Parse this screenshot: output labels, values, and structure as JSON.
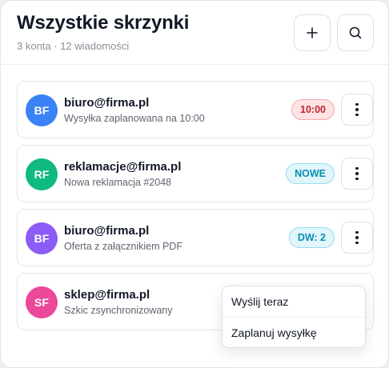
{
  "header": {
    "title": "Wszystkie skrzynki",
    "subtitle": "3 konta · 12 wiadomości"
  },
  "icons": {
    "add": "plus-icon",
    "search": "search-icon",
    "more": "more-vertical-icon"
  },
  "colors": {
    "avatar_blue": "#3b82f6",
    "avatar_green": "#10b981",
    "avatar_purple": "#8b5cf6",
    "avatar_pink": "#ec4899",
    "badge_red": "#c0262d",
    "badge_cyan": "#0b8db0"
  },
  "items": [
    {
      "initials": "BF",
      "email": "biuro@firma.pl",
      "snippet": "Wysyłka zaplanowana na 10:00",
      "badge": "10:00"
    },
    {
      "initials": "RF",
      "email": "reklamacje@firma.pl",
      "snippet": "Nowa reklamacja #2048",
      "badge": "NOWE"
    },
    {
      "initials": "BF",
      "email": "biuro@firma.pl",
      "snippet": "Oferta z załącznikiem PDF",
      "badge": "DW: 2"
    },
    {
      "initials": "SF",
      "email": "sklep@firma.pl",
      "snippet": "Szkic zsynchronizowany",
      "badge": ""
    }
  ],
  "menu": {
    "items": [
      {
        "label": "Wyślij teraz"
      },
      {
        "label": "Zaplanuj wysyłkę"
      }
    ]
  }
}
